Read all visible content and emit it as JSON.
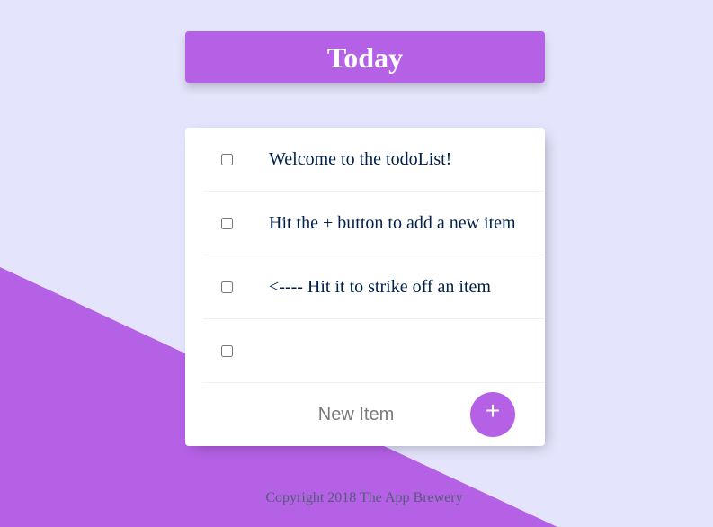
{
  "colors": {
    "background": "#e4e4fc",
    "accent": "#b561e6",
    "item_text": "#00204a",
    "card": "#ffffff"
  },
  "header": {
    "title": "Today"
  },
  "todo": {
    "items": [
      {
        "text": "Welcome to the todoList!",
        "checked": false
      },
      {
        "text": "Hit the + button to add a new item",
        "checked": false
      },
      {
        "text": "<---- Hit it to strike off an item",
        "checked": false
      },
      {
        "text": "",
        "checked": false
      }
    ],
    "new_item_placeholder": "New Item",
    "add_button_label": "+"
  },
  "footer": {
    "text": "Copyright 2018 The App Brewery"
  }
}
